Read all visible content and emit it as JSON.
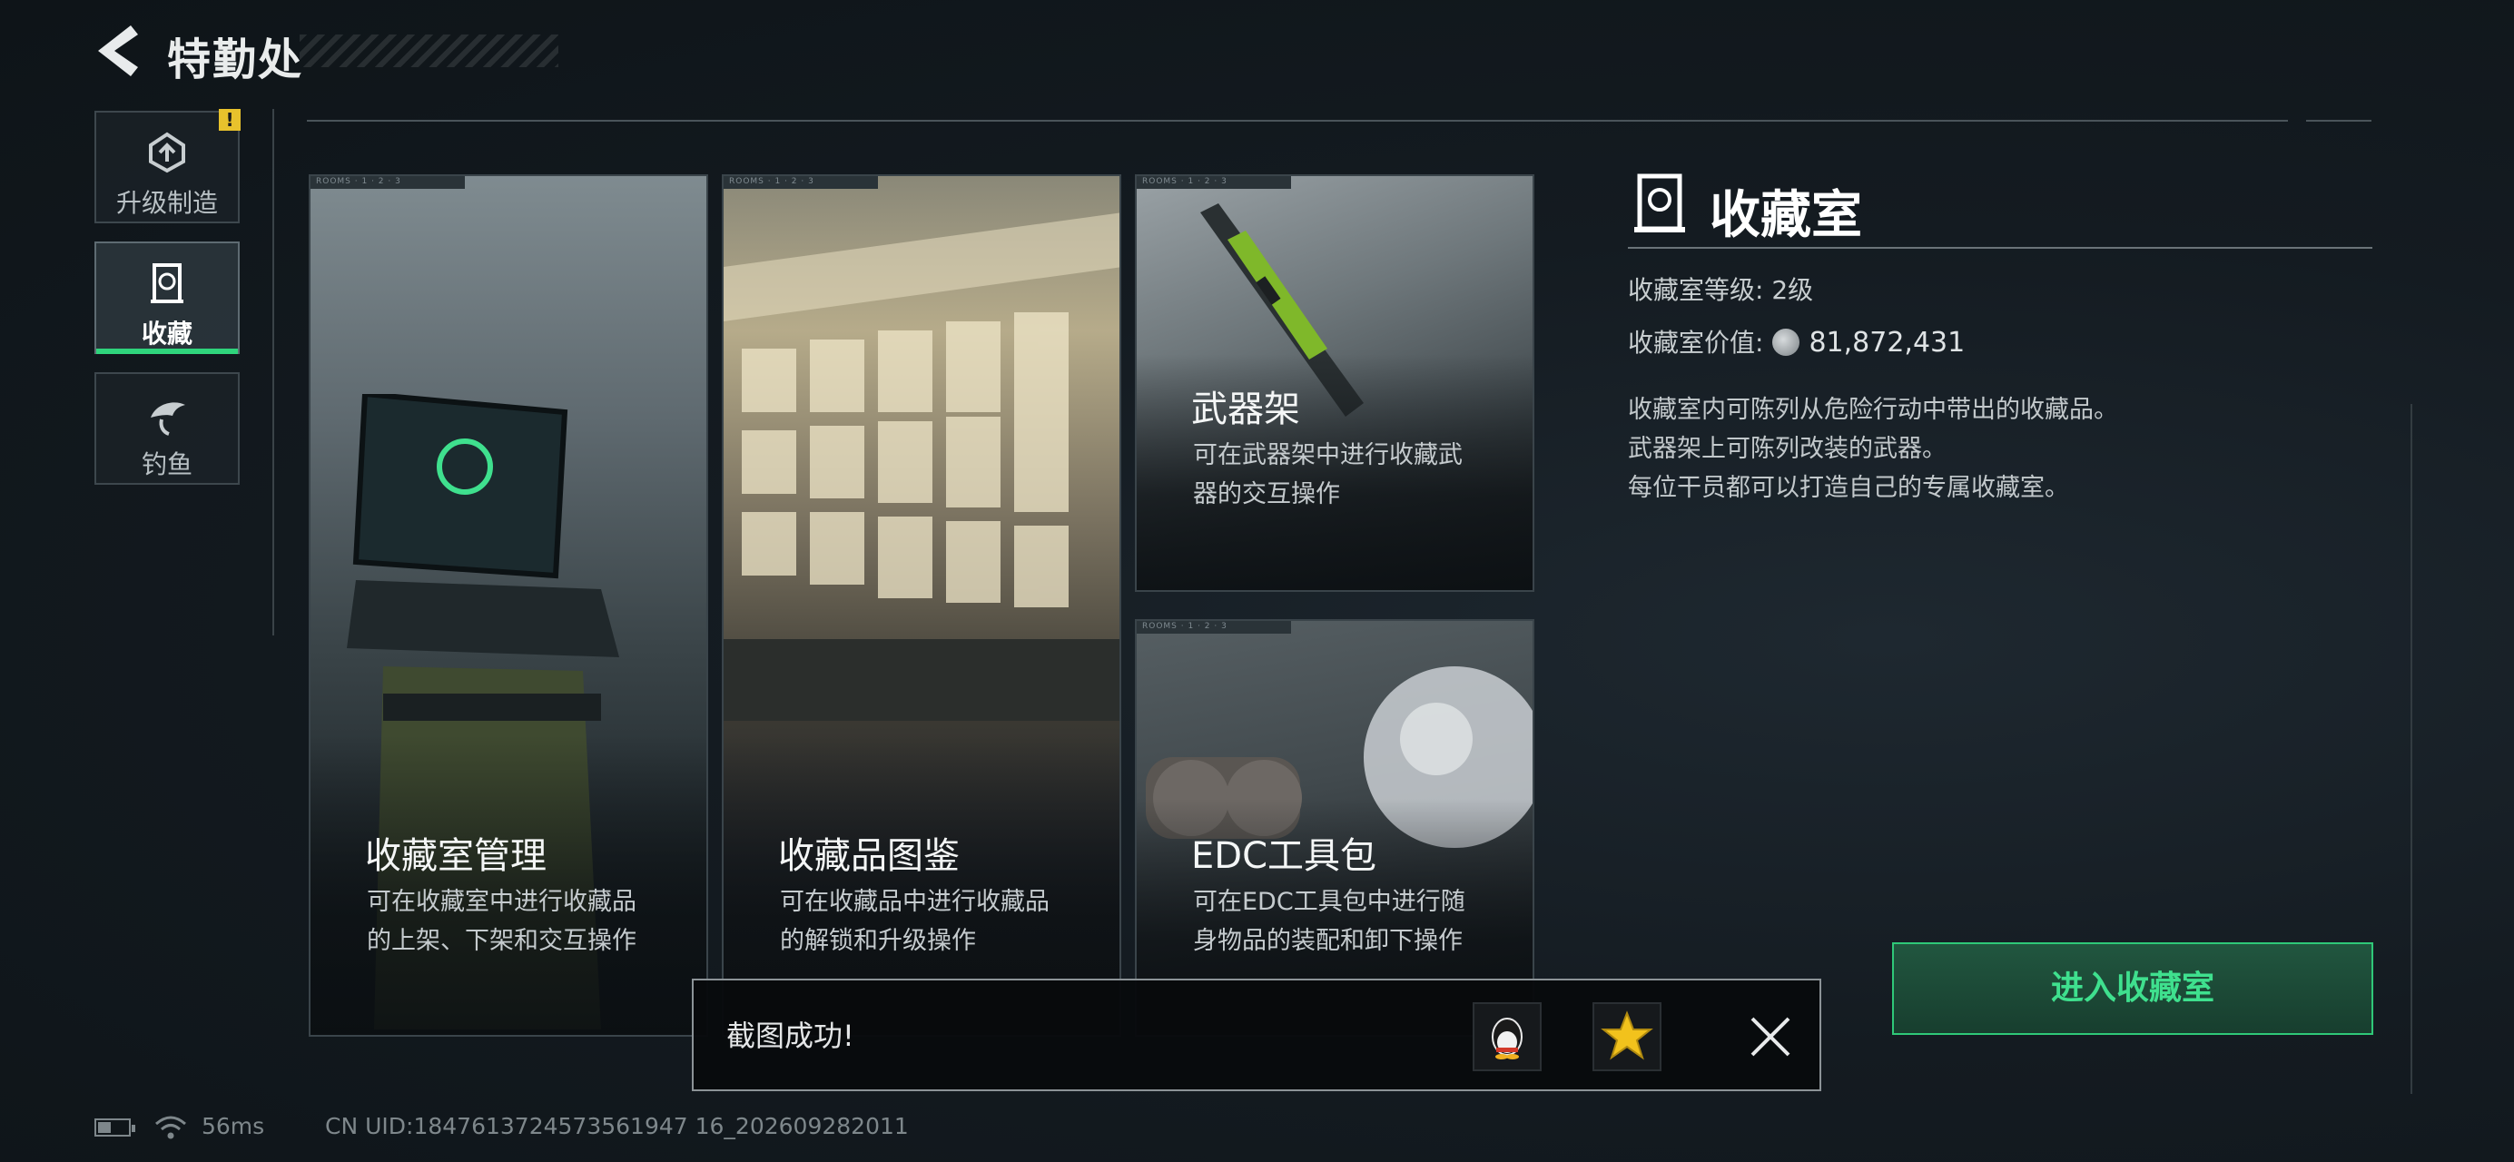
{
  "header": {
    "title": "特勤处"
  },
  "nav": {
    "alert_badge": "!",
    "items": [
      {
        "label": "升级制造",
        "icon": "upgrade-craft-icon"
      },
      {
        "label": "收藏",
        "icon": "collection-icon",
        "active": true
      },
      {
        "label": "钓鱼",
        "icon": "fishing-icon"
      }
    ]
  },
  "cards": [
    {
      "title": "收藏室管理",
      "desc1": "可在收藏室中进行收藏品",
      "desc2": "的上架、下架和交互操作"
    },
    {
      "title": "收藏品图鉴",
      "desc1": "可在收藏品中进行收藏品",
      "desc2": "的解锁和升级操作"
    },
    {
      "title": "武器架",
      "desc1": "可在武器架中进行收藏武",
      "desc2": "器的交互操作"
    },
    {
      "title": "EDC工具包",
      "desc1": "可在EDC工具包中进行随",
      "desc2": "身物品的装配和卸下操作"
    }
  ],
  "info": {
    "title": "收藏室",
    "level_label": "收藏室等级:",
    "level_value": "2级",
    "value_label": "收藏室价值:",
    "value": "81,872,431",
    "desc": [
      "收藏室内可陈列从危险行动中带出的收藏品。",
      "武器架上可陈列改装的武器。",
      "每位干员都可以打造自己的专属收藏室。"
    ],
    "enter_button": "进入收藏室"
  },
  "toast": {
    "text": "截图成功!",
    "share_icons": [
      "qq-icon",
      "qzone-star-icon"
    ]
  },
  "status_bar": {
    "latency": "56ms",
    "uid": "CN UID:1847613724573561947 16_202609282011"
  },
  "colors": {
    "accent_green": "#2fd47c",
    "alert_yellow": "#e8c22c"
  }
}
